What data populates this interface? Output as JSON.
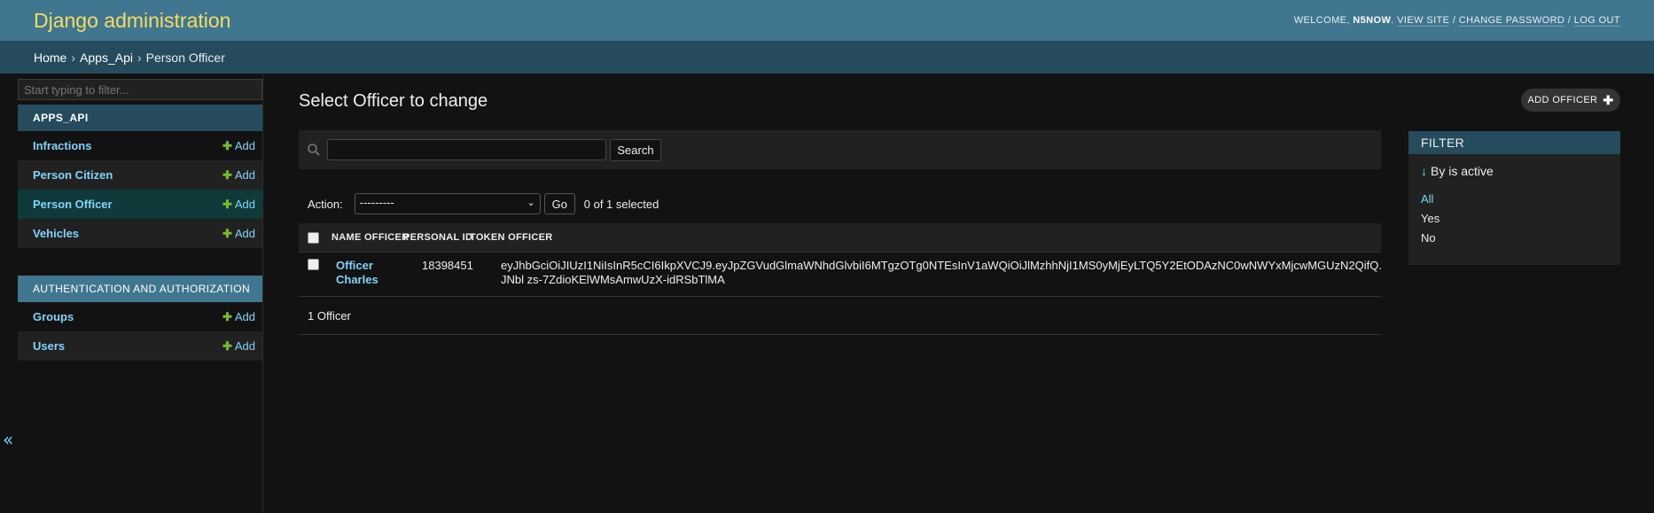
{
  "header": {
    "site_title": "Django administration",
    "welcome": "Welcome,",
    "username": "N5NOW",
    "view_site": "View site",
    "change_password": "Change password",
    "log_out": "Log out",
    "separator": "/"
  },
  "breadcrumbs": {
    "home": "Home",
    "app": "Apps_Api",
    "current": "Person Officer",
    "separator": "›"
  },
  "sidebar": {
    "filter_placeholder": "Start typing to filter...",
    "modules": [
      {
        "caption": "APPS_API",
        "items": [
          {
            "label": "Infractions",
            "add": "Add"
          },
          {
            "label": "Person Citizen",
            "add": "Add"
          },
          {
            "label": "Person Officer",
            "add": "Add"
          },
          {
            "label": "Vehicles",
            "add": "Add"
          }
        ]
      },
      {
        "caption": "AUTHENTICATION AND AUTHORIZATION",
        "items": [
          {
            "label": "Groups",
            "add": "Add"
          },
          {
            "label": "Users",
            "add": "Add"
          }
        ]
      }
    ],
    "collapse_glyph": "«",
    "plus_glyph": "✚"
  },
  "main": {
    "title": "Select Officer to change",
    "add_button": "Add Officer",
    "search_button": "Search",
    "action_label": "Action:",
    "action_selected": "---------",
    "go_button": "Go",
    "selected_counter": "0 of 1 selected",
    "table": {
      "columns": [
        "Name Officer",
        "Personal ID",
        "Token Officer"
      ],
      "rows": [
        {
          "name": "Officer Charles",
          "personal_id": "18398451",
          "token": "eyJhbGciOiJIUzI1NiIsInR5cCI6IkpXVCJ9.eyJpZGVudGlmaWNhdGlvbiI6MTgzOTg0NTEsInV1aWQiOiJlMzhhNjI1MS0yMjEyLTQ5Y2EtODAzNC0wNWYxMjcwMGUzN2QifQ.JNbl zs-7ZdioKElWMsAmwUzX-idRSbTlMA"
        }
      ]
    },
    "paginator": "1 Officer"
  },
  "filter": {
    "title": "FILTER",
    "heading": "By is active",
    "arrow_glyph": "↓",
    "options": [
      "All",
      "Yes",
      "No"
    ],
    "selected": "All"
  },
  "colors": {
    "header_bg": "#417690",
    "breadcrumbs_bg": "#264b5d",
    "site_title": "#f5dd5d",
    "link": "#81d4fa",
    "add_green": "#70bf2b",
    "body_bg": "#121212"
  }
}
